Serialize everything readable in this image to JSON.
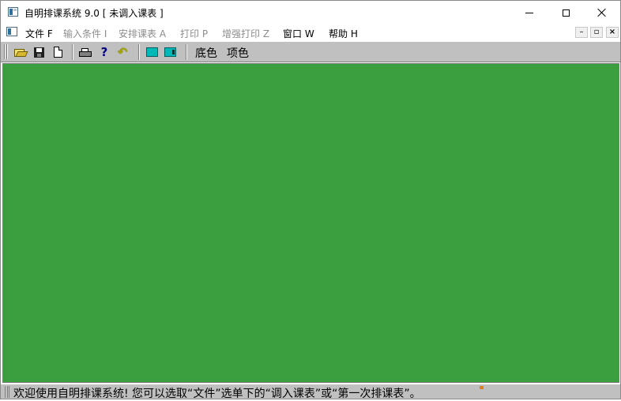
{
  "window": {
    "title": "自明排课系统 9.0 [ 未调入课表 ]"
  },
  "menu": {
    "items": [
      {
        "label": "文件 F",
        "enabled": true
      },
      {
        "label": "输入条件 I",
        "enabled": false
      },
      {
        "label": "安排课表 A",
        "enabled": false
      },
      {
        "label": "打印 P",
        "enabled": false
      },
      {
        "label": "增强打印 Z",
        "enabled": false
      },
      {
        "label": "窗口 W",
        "enabled": true
      },
      {
        "label": "帮助 H",
        "enabled": true
      }
    ]
  },
  "toolbar": {
    "icons": [
      "open-folder-icon",
      "save-icon",
      "new-file-icon",
      "print-icon",
      "help-icon",
      "undo-icon",
      "background-color-icon",
      "item-color-icon"
    ],
    "background_color_label": "底色",
    "item_color_label": "项色"
  },
  "colors": {
    "client_background": "#3c9f3f",
    "toolbar_background": "#c0c0c0",
    "disabled_menu_text": "#8d8d8d"
  },
  "statusbar": {
    "message": "欢迎使用自明排课系统!  您可以选取“文件”选单下的“调入课表”或“第一次排课表”。"
  }
}
